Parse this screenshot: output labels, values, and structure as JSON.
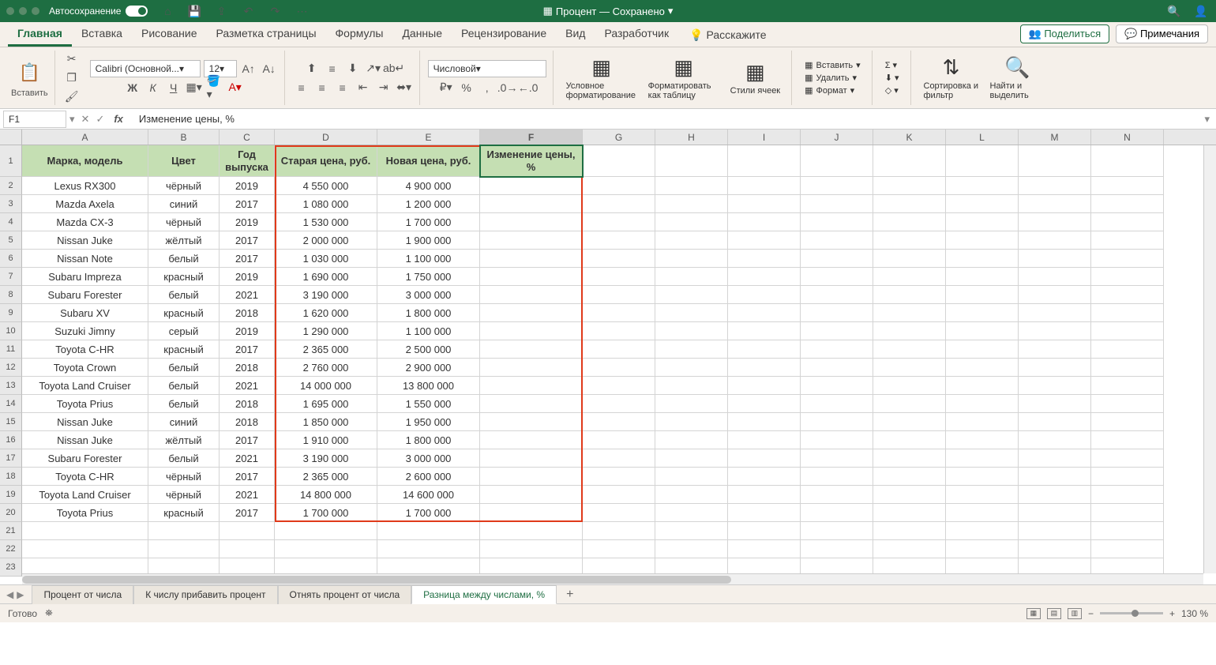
{
  "titlebar": {
    "autosave_label": "Автосохранение",
    "autosave_state": "вкл.",
    "doc_title": "Процент — Сохранено"
  },
  "menu": {
    "tabs": [
      "Главная",
      "Вставка",
      "Рисование",
      "Разметка страницы",
      "Формулы",
      "Данные",
      "Рецензирование",
      "Вид",
      "Разработчик"
    ],
    "tell_me": "Расскажите",
    "share": "Поделиться",
    "comments": "Примечания"
  },
  "ribbon": {
    "paste": "Вставить",
    "font_name": "Calibri (Основной...",
    "font_size": "12",
    "number_format": "Числовой",
    "cond_fmt": "Условное форматирование",
    "fmt_table": "Форматировать как таблицу",
    "cell_styles": "Стили ячеек",
    "insert": "Вставить",
    "delete": "Удалить",
    "format": "Формат",
    "sort_filter": "Сортировка и фильтр",
    "find_select": "Найти и выделить"
  },
  "formula_bar": {
    "name_box": "F1",
    "formula": "Изменение цены, %"
  },
  "columns": [
    "A",
    "B",
    "C",
    "D",
    "E",
    "F",
    "G",
    "H",
    "I",
    "J",
    "K",
    "L",
    "M",
    "N"
  ],
  "headers": [
    "Марка, модель",
    "Цвет",
    "Год выпуска",
    "Старая цена, руб.",
    "Новая цена, руб.",
    "Изменение цены, %"
  ],
  "rows": [
    {
      "a": "Lexus RX300",
      "b": "чёрный",
      "c": "2019",
      "d": "4 550 000",
      "e": "4 900 000"
    },
    {
      "a": "Mazda Axela",
      "b": "синий",
      "c": "2017",
      "d": "1 080 000",
      "e": "1 200 000"
    },
    {
      "a": "Mazda CX-3",
      "b": "чёрный",
      "c": "2019",
      "d": "1 530 000",
      "e": "1 700 000"
    },
    {
      "a": "Nissan Juke",
      "b": "жёлтый",
      "c": "2017",
      "d": "2 000 000",
      "e": "1 900 000"
    },
    {
      "a": "Nissan Note",
      "b": "белый",
      "c": "2017",
      "d": "1 030 000",
      "e": "1 100 000"
    },
    {
      "a": "Subaru Impreza",
      "b": "красный",
      "c": "2019",
      "d": "1 690 000",
      "e": "1 750 000"
    },
    {
      "a": "Subaru Forester",
      "b": "белый",
      "c": "2021",
      "d": "3 190 000",
      "e": "3 000 000"
    },
    {
      "a": "Subaru XV",
      "b": "красный",
      "c": "2018",
      "d": "1 620 000",
      "e": "1 800 000"
    },
    {
      "a": "Suzuki Jimny",
      "b": "серый",
      "c": "2019",
      "d": "1 290 000",
      "e": "1 100 000"
    },
    {
      "a": "Toyota C-HR",
      "b": "красный",
      "c": "2017",
      "d": "2 365 000",
      "e": "2 500 000"
    },
    {
      "a": "Toyota Crown",
      "b": "белый",
      "c": "2018",
      "d": "2 760 000",
      "e": "2 900 000"
    },
    {
      "a": "Toyota Land Cruiser",
      "b": "белый",
      "c": "2021",
      "d": "14 000 000",
      "e": "13 800 000"
    },
    {
      "a": "Toyota Prius",
      "b": "белый",
      "c": "2018",
      "d": "1 695 000",
      "e": "1 550 000"
    },
    {
      "a": "Nissan Juke",
      "b": "синий",
      "c": "2018",
      "d": "1 850 000",
      "e": "1 950 000"
    },
    {
      "a": "Nissan Juke",
      "b": "жёлтый",
      "c": "2017",
      "d": "1 910 000",
      "e": "1 800 000"
    },
    {
      "a": "Subaru Forester",
      "b": "белый",
      "c": "2021",
      "d": "3 190 000",
      "e": "3 000 000"
    },
    {
      "a": "Toyota C-HR",
      "b": "чёрный",
      "c": "2017",
      "d": "2 365 000",
      "e": "2 600 000"
    },
    {
      "a": "Toyota Land Cruiser",
      "b": "чёрный",
      "c": "2021",
      "d": "14 800 000",
      "e": "14 600 000"
    },
    {
      "a": "Toyota Prius",
      "b": "красный",
      "c": "2017",
      "d": "1 700 000",
      "e": "1 700 000"
    }
  ],
  "sheets": {
    "tabs": [
      "Процент от числа",
      "К числу прибавить процент",
      "Отнять процент от числа",
      "Разница между числами, %"
    ],
    "active": 3
  },
  "status": {
    "ready": "Готово",
    "zoom": "130 %"
  }
}
